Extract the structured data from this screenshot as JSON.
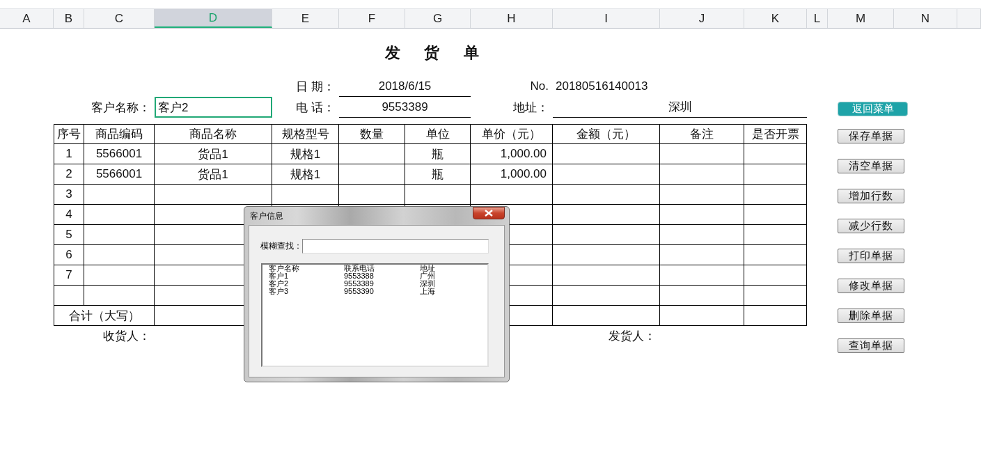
{
  "column_headers": [
    {
      "label": "A",
      "selected": false
    },
    {
      "label": "B",
      "selected": false
    },
    {
      "label": "C",
      "selected": false
    },
    {
      "label": "D",
      "selected": true
    },
    {
      "label": "E",
      "selected": false
    },
    {
      "label": "F",
      "selected": false
    },
    {
      "label": "G",
      "selected": false
    },
    {
      "label": "H",
      "selected": false
    },
    {
      "label": "I",
      "selected": false
    },
    {
      "label": "J",
      "selected": false
    },
    {
      "label": "K",
      "selected": false
    },
    {
      "label": "L",
      "selected": false
    },
    {
      "label": "M",
      "selected": false
    },
    {
      "label": "N",
      "selected": false
    }
  ],
  "header": {
    "title": "发 货 单",
    "date_label": "日 期：",
    "date": "2018/6/15",
    "no_label": "No.",
    "no": "20180516140013",
    "customer_label": "客户名称：",
    "customer": {
      "value": "客户2",
      "selected": true
    },
    "phone_label": "电 话：",
    "phone": "9553389",
    "address_label": "地址：",
    "address": "深圳"
  },
  "table": {
    "columns": [
      "序号",
      "商品编码",
      "商品名称",
      "规格型号",
      "数量",
      "单位",
      "单价（元）",
      "金额（元）",
      "备注",
      "是否开票"
    ],
    "rows": [
      {
        "no": "1",
        "code": "5566001",
        "name": "货品1",
        "spec": "规格1",
        "unit": "瓶",
        "price": "1,000.00"
      },
      {
        "no": "2",
        "code": "5566001",
        "name": "货品1",
        "spec": "规格1",
        "unit": "瓶",
        "price": "1,000.00"
      },
      {
        "no": "3"
      },
      {
        "no": "4"
      },
      {
        "no": "5"
      },
      {
        "no": "6"
      },
      {
        "no": "7"
      },
      {}
    ],
    "total_label": "合计（大写）"
  },
  "signatures": {
    "receiver": "收货人：",
    "sender": "发货人："
  },
  "buttons": [
    {
      "label": "返回菜单",
      "kind": "primary"
    },
    {
      "label": "保存单据",
      "kind": "plain"
    },
    {
      "label": "清空单据",
      "kind": "plain"
    },
    {
      "label": "增加行数",
      "kind": "plain"
    },
    {
      "label": "减少行数",
      "kind": "plain"
    },
    {
      "label": "打印单据",
      "kind": "plain"
    },
    {
      "label": "修改单据",
      "kind": "plain"
    },
    {
      "label": "删除单据",
      "kind": "plain"
    },
    {
      "label": "查询单据",
      "kind": "plain"
    }
  ],
  "dialog": {
    "title": "客户信息",
    "search_label": "模糊查找：",
    "list": {
      "columns": [
        "客户名称",
        "联系电话",
        "地址"
      ],
      "rows": [
        [
          "客户1",
          "9553388",
          "广州"
        ],
        [
          "客户2",
          "9553389",
          "深圳"
        ],
        [
          "客户3",
          "9553390",
          "上海"
        ]
      ]
    }
  }
}
